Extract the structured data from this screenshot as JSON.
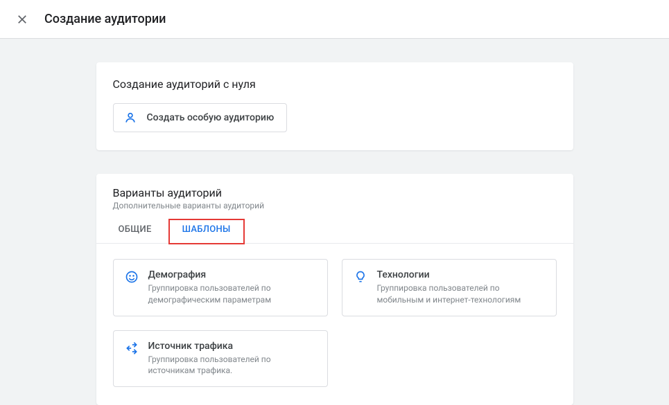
{
  "header": {
    "title": "Создание аудитории"
  },
  "panel_top": {
    "title": "Создание аудиторий с нуля",
    "create_btn": "Создать особую аудиторию"
  },
  "panel_bottom": {
    "title": "Варианты аудиторий",
    "subtitle": "Дополнительные варианты аудиторий",
    "tabs": {
      "general": "ОБЩИЕ",
      "templates": "ШАБЛОНЫ"
    },
    "templates": {
      "demography": {
        "title": "Демография",
        "desc": "Группировка пользователей по демографическим параметрам"
      },
      "technology": {
        "title": "Технологии",
        "desc": "Группировка пользователей по мобильным и интернет-технологиям"
      },
      "traffic": {
        "title": "Источник трафика",
        "desc": "Группировка пользователей по источникам трафика."
      }
    }
  }
}
